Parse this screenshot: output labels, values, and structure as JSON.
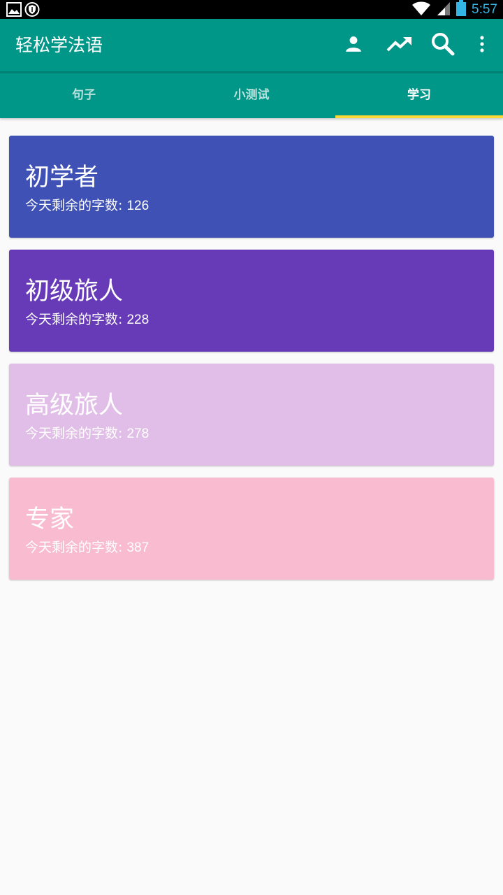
{
  "status_bar": {
    "time": "5:57",
    "left_icons": [
      "image-icon",
      "shield-icon"
    ],
    "right_icons": [
      "wifi-icon",
      "signal-icon",
      "battery-icon"
    ],
    "time_color": "#33b5e5"
  },
  "app_bar": {
    "title": "轻松学法语",
    "color": "#009688",
    "actions": [
      "person-icon",
      "trending-up-icon",
      "search-icon",
      "more-vert-icon"
    ]
  },
  "tabs": [
    {
      "label": "句子",
      "active": false
    },
    {
      "label": "小测试",
      "active": false
    },
    {
      "label": "学习",
      "active": true
    }
  ],
  "tab_indicator_color": "#fdd835",
  "levels": [
    {
      "title": "初学者",
      "subtitle_prefix": "今天剩余的字数: ",
      "count": "126",
      "color": "#3f51b5"
    },
    {
      "title": "初级旅人",
      "subtitle_prefix": "今天剩余的字数: ",
      "count": "228",
      "color": "#673ab7"
    },
    {
      "title": "高级旅人",
      "subtitle_prefix": "今天剩余的字数: ",
      "count": "278",
      "color": "#e1bee7"
    },
    {
      "title": "专家",
      "subtitle_prefix": "今天剩余的字数: ",
      "count": "387",
      "color": "#f8bbd0"
    }
  ]
}
